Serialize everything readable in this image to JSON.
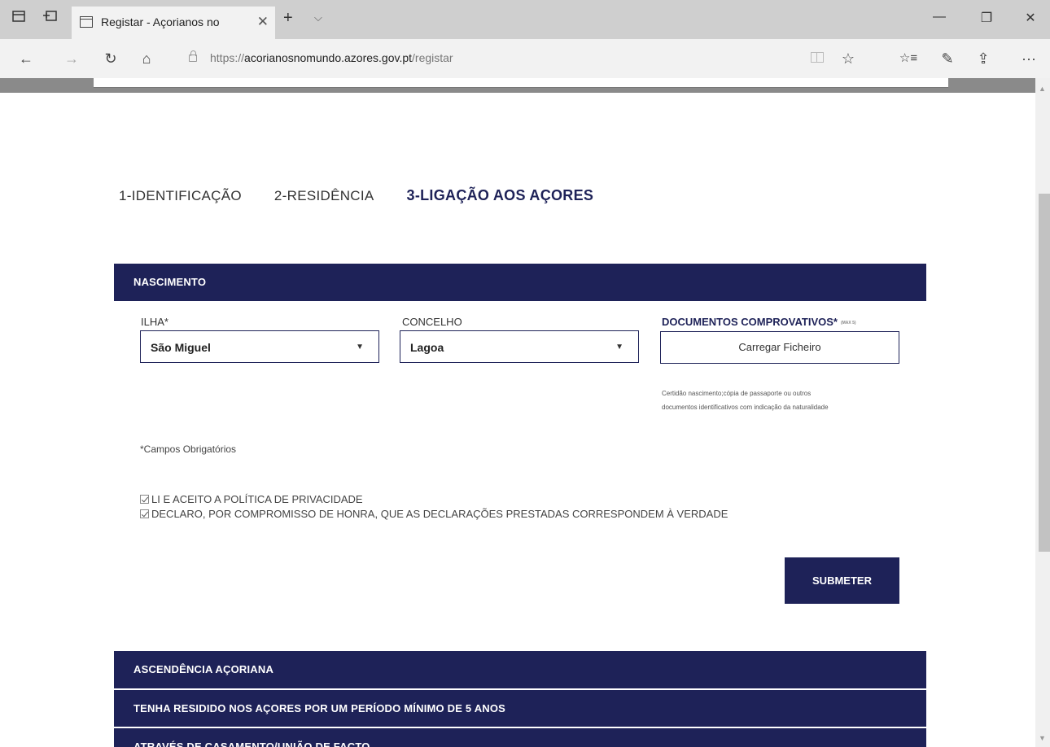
{
  "browser": {
    "tab_title": "Registar - Açorianos no",
    "tab_close": "✕",
    "new_tab": "+",
    "tab_menu": "⌵",
    "window_controls": {
      "minimize": "—",
      "restore": "❐",
      "close": "✕"
    },
    "nav": {
      "back": "←",
      "forward": "→",
      "refresh": "↻",
      "home": "⌂"
    },
    "url": {
      "scheme": "https://",
      "host": "acorianosnomundo.azores.gov.pt",
      "path": "/registar"
    },
    "toolbar": {
      "favorite": "☆",
      "favorites_hub": "☆≡",
      "notes": "✎",
      "share": "⇪",
      "more": "···"
    },
    "icons": [
      "set-aside-tabs-icon",
      "tab-preview-icon",
      "lock-icon",
      "reading-view-icon"
    ]
  },
  "steps": [
    {
      "label": "1-IDENTIFICAÇÃO"
    },
    {
      "label": "2-RESIDÊNCIA"
    },
    {
      "label": "3-LIGAÇÃO AOS AÇORES",
      "active": true
    }
  ],
  "nascimento": {
    "title": "NASCIMENTO",
    "ilha": {
      "label": "ILHA*",
      "value": "São Miguel"
    },
    "concelho": {
      "label": "CONCELHO",
      "value": "Lagoa"
    },
    "documentos": {
      "label": "DOCUMENTOS COMPROVATIVOS*",
      "tiny_note": "(MAX 5)",
      "button": "Carregar Ficheiro",
      "help_line1": "Certidão nascimento;cópia de passaporte ou outros",
      "help_line2": "documentos identificativos com indicação da naturalidade"
    },
    "required_note": "*Campos Obrigatórios",
    "checks": [
      {
        "label": "LI E ACEITO A POLÍTICA DE PRIVACIDADE",
        "checked": true
      },
      {
        "label": "DECLARO, POR COMPROMISSO DE HONRA, QUE AS DECLARAÇÕES PRESTADAS CORRESPONDEM À VERDADE",
        "checked": true
      }
    ],
    "submit": "SUBMETER"
  },
  "sections": [
    {
      "title": "ASCENDÊNCIA AÇORIANA"
    },
    {
      "title": "TENHA RESIDIDO NOS AÇORES POR UM PERÍODO MÍNIMO DE 5 ANOS"
    },
    {
      "title": "ATRAVÉS DE CASAMENTO/UNIÃO DE FACTO"
    }
  ],
  "colors": {
    "primary": "#1e2258",
    "chrome": "#cfcfcf",
    "toolbar": "#f2f2f2"
  }
}
